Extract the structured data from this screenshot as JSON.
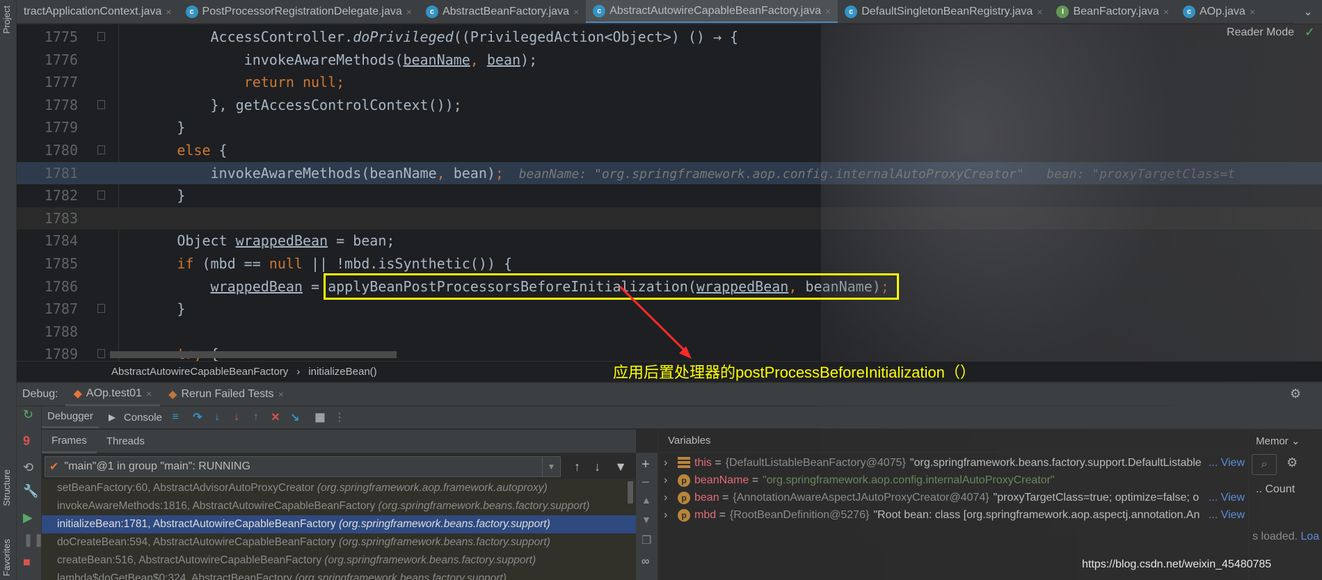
{
  "sidebar_left": {
    "project": "Project",
    "structure": "Structure",
    "favorites": "Favorites"
  },
  "tabs": [
    {
      "label": "tractApplicationContext.java",
      "icon": "class",
      "active": false
    },
    {
      "label": "PostProcessorRegistrationDelegate.java",
      "icon": "class",
      "active": false
    },
    {
      "label": "AbstractBeanFactory.java",
      "icon": "class",
      "active": false
    },
    {
      "label": "AbstractAutowireCapableBeanFactory.java",
      "icon": "class",
      "active": true
    },
    {
      "label": "DefaultSingletonBeanRegistry.java",
      "icon": "class",
      "active": false
    },
    {
      "label": "BeanFactory.java",
      "icon": "interface",
      "active": false
    },
    {
      "label": "AOp.java",
      "icon": "class",
      "active": false
    }
  ],
  "editor": {
    "reader_mode": "Reader Mode",
    "lines": [
      {
        "n": "1775",
        "indent": 12,
        "tokens": [
          [
            "AccessController.",
            ""
          ],
          [
            "doPrivileged",
            "italic"
          ],
          [
            "((PrivilegedAction<Object>) () → {",
            ""
          ]
        ]
      },
      {
        "n": "1776",
        "indent": 16,
        "tokens": [
          [
            "invokeAwareMethods(",
            ""
          ],
          [
            "beanName",
            "var"
          ],
          [
            ", ",
            "keyword"
          ],
          [
            "bean",
            "var"
          ],
          [
            ");",
            ""
          ]
        ]
      },
      {
        "n": "1777",
        "indent": 16,
        "tokens": [
          [
            "return null",
            "keyword"
          ],
          [
            ";",
            "keyword"
          ]
        ]
      },
      {
        "n": "1778",
        "indent": 12,
        "tokens": [
          [
            "}, getAccessControlContext());",
            ""
          ]
        ]
      },
      {
        "n": "1779",
        "indent": 8,
        "tokens": [
          [
            "}",
            ""
          ]
        ]
      },
      {
        "n": "1780",
        "indent": 8,
        "tokens": [
          [
            "else",
            "keyword"
          ],
          [
            " {",
            ""
          ]
        ]
      },
      {
        "n": "1781",
        "indent": 12,
        "state": "exec",
        "tokens": [
          [
            "invokeAwareMethods(beanName",
            ""
          ],
          [
            ", ",
            "keyword"
          ],
          [
            "bean)",
            ""
          ],
          [
            ";",
            "keyword"
          ],
          [
            "  beanName: \"org.springframework.aop.config.internalAutoProxyCreator\"   bean: \"proxyTargetClass=t",
            "hint"
          ]
        ]
      },
      {
        "n": "1782",
        "indent": 8,
        "tokens": [
          [
            "}",
            ""
          ]
        ]
      },
      {
        "n": "1783",
        "indent": 0,
        "state": "cur",
        "tokens": []
      },
      {
        "n": "1784",
        "indent": 8,
        "tokens": [
          [
            "Object ",
            ""
          ],
          [
            "wrappedBean",
            "var"
          ],
          [
            " = bean;",
            ""
          ]
        ]
      },
      {
        "n": "1785",
        "indent": 8,
        "tokens": [
          [
            "if",
            "keyword"
          ],
          [
            " (mbd == ",
            ""
          ],
          [
            "null",
            "keyword"
          ],
          [
            " || !mbd.isSynthetic()) {",
            ""
          ]
        ]
      },
      {
        "n": "1786",
        "indent": 12,
        "tokens": [
          [
            "wrappedBean",
            "var"
          ],
          [
            " = applyBeanPostProcessorsBeforeInitialization(",
            ""
          ],
          [
            "wrappedBean",
            "var"
          ],
          [
            ", ",
            "keyword"
          ],
          [
            "beanName)",
            ""
          ],
          [
            ";",
            "keyword"
          ]
        ]
      },
      {
        "n": "1787",
        "indent": 8,
        "tokens": [
          [
            "}",
            ""
          ]
        ]
      },
      {
        "n": "1788",
        "indent": 0,
        "tokens": []
      },
      {
        "n": "1789",
        "indent": 8,
        "tokens": [
          [
            "try",
            "keyword"
          ],
          [
            " {",
            ""
          ]
        ]
      }
    ]
  },
  "annotation": {
    "text": "应用后置处理器的postProcessBeforeInitialization（）",
    "color": "#ffff00",
    "arrow_color": "#ff2a2a"
  },
  "breadcrumb": {
    "class": "AbstractAutowireCapableBeanFactory",
    "sep": "›",
    "method": "initializeBean()"
  },
  "debug": {
    "label": "Debug:",
    "tabs": [
      {
        "label": "AOp.test01"
      },
      {
        "label": "Rerun Failed Tests"
      }
    ],
    "toolbar": {
      "debugger": "Debugger",
      "console": "Console"
    },
    "frame_tabs": {
      "frames": "Frames",
      "threads": "Threads"
    },
    "thread": "\"main\"@1 in group \"main\": RUNNING",
    "frames": [
      {
        "method": "setBeanFactory:60, AbstractAdvisorAutoProxyCreator",
        "pkg": "(org.springframework.aop.framework.autoproxy)"
      },
      {
        "method": "invokeAwareMethods:1816, AbstractAutowireCapableBeanFactory",
        "pkg": "(org.springframework.beans.factory.support)"
      },
      {
        "method": "initializeBean:1781, AbstractAutowireCapableBeanFactory",
        "pkg": "(org.springframework.beans.factory.support)",
        "selected": true
      },
      {
        "method": "doCreateBean:594, AbstractAutowireCapableBeanFactory",
        "pkg": "(org.springframework.beans.factory.support)"
      },
      {
        "method": "createBean:516, AbstractAutowireCapableBeanFactory",
        "pkg": "(org.springframework.beans.factory.support)"
      },
      {
        "method": "lambda$doGetBean$0:324, AbstractBeanFactory",
        "pkg": "(org.springframework.beans.factory.support)"
      }
    ],
    "variables_title": "Variables",
    "variables": [
      {
        "name": "this",
        "icon": "list",
        "type": "{DefaultListableBeanFactory@4075}",
        "value": "\"org.springframework.beans.factory.support.DefaultListable",
        "more": "... View"
      },
      {
        "name": "beanName",
        "icon": "p",
        "string": "\"org.springframework.aop.config.internalAutoProxyCreator\""
      },
      {
        "name": "bean",
        "icon": "p",
        "type": "{AnnotationAwareAspectJAutoProxyCreator@4074}",
        "value": "\"proxyTargetClass=true; optimize=false; o",
        "more": "... View"
      },
      {
        "name": "mbd",
        "icon": "p",
        "type": "{RootBeanDefinition@5276}",
        "value": "\"Root bean: class [org.springframework.aop.aspectj.annotation.An",
        "more": "... View"
      }
    ],
    "memory": {
      "tab": "Memor",
      "count": "..  Count",
      "loaded": "s loaded. ",
      "load_link": "Loa"
    }
  },
  "watermark": "https://blog.csdn.net/weixin_45480785"
}
